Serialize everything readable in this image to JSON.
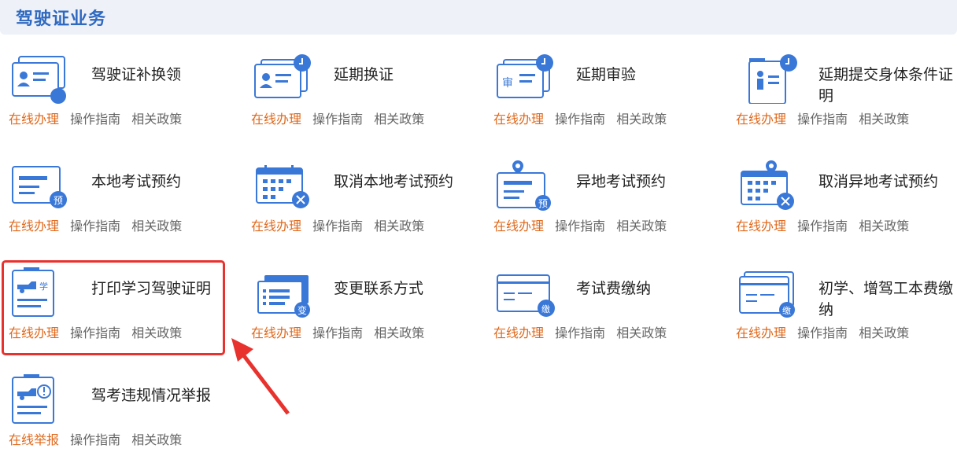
{
  "header": {
    "title": "驾驶证业务"
  },
  "services": [
    {
      "title": "驾驶证补换领",
      "icon": "license-replace-icon",
      "links": [
        "在线办理",
        "操作指南",
        "相关政策"
      ]
    },
    {
      "title": "延期换证",
      "icon": "license-extend-icon",
      "links": [
        "在线办理",
        "操作指南",
        "相关政策"
      ]
    },
    {
      "title": "延期审验",
      "icon": "review-extend-icon",
      "badge": "审",
      "links": [
        "在线办理",
        "操作指南",
        "相关政策"
      ]
    },
    {
      "title": "延期提交身体条件证明",
      "icon": "health-certificate-icon",
      "links": [
        "在线办理",
        "操作指南",
        "相关政策"
      ]
    },
    {
      "title": "本地考试预约",
      "icon": "local-exam-booking-icon",
      "badge": "预",
      "links": [
        "在线办理",
        "操作指南",
        "相关政策"
      ]
    },
    {
      "title": "取消本地考试预约",
      "icon": "cancel-local-exam-icon",
      "links": [
        "在线办理",
        "操作指南",
        "相关政策"
      ]
    },
    {
      "title": "异地考试预约",
      "icon": "remote-exam-booking-icon",
      "badge": "预",
      "links": [
        "在线办理",
        "操作指南",
        "相关政策"
      ]
    },
    {
      "title": "取消异地考试预约",
      "icon": "cancel-remote-exam-icon",
      "links": [
        "在线办理",
        "操作指南",
        "相关政策"
      ]
    },
    {
      "title": "打印学习驾驶证明",
      "icon": "print-learner-permit-icon",
      "badge": "学",
      "links": [
        "在线办理",
        "操作指南",
        "相关政策"
      ]
    },
    {
      "title": "变更联系方式",
      "icon": "change-contact-icon",
      "badge": "变",
      "links": [
        "在线办理",
        "操作指南",
        "相关政策"
      ]
    },
    {
      "title": "考试费缴纳",
      "icon": "exam-fee-payment-icon",
      "badge": "缴",
      "links": [
        "在线办理",
        "操作指南",
        "相关政策"
      ]
    },
    {
      "title": "初学、增驾工本费缴纳",
      "icon": "learner-fee-payment-icon",
      "badge": "缴",
      "links": [
        "在线办理",
        "操作指南",
        "相关政策"
      ]
    },
    {
      "title": "驾考违规情况举报",
      "icon": "violation-report-icon",
      "links": [
        "在线举报",
        "操作指南",
        "相关政策"
      ]
    }
  ],
  "colors": {
    "primary": "#2f69c0",
    "icon_blue": "#3a78d8",
    "link_orange": "#e0691c",
    "highlight_red": "#e8322e"
  }
}
